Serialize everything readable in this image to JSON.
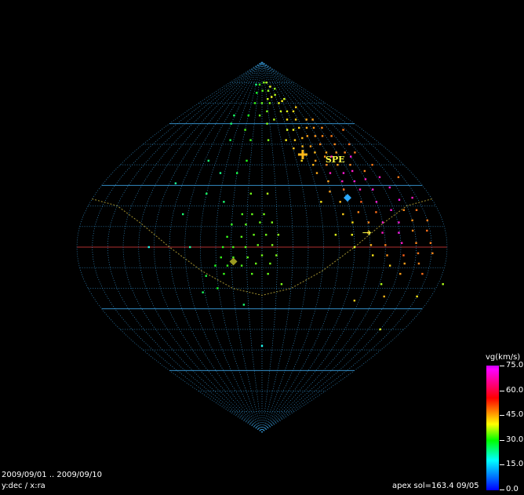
{
  "chart_data": {
    "type": "scatter",
    "projection": "sinusoidal",
    "title": "",
    "xlabel": "ra",
    "ylabel": "dec",
    "date_range_text": "2009/09/01 .. 2009/09/10",
    "axes_text": "y:dec / x:ra",
    "apex_text": "apex sol=163.4 09/05",
    "shower_label": "SPE",
    "shower_label_color": "#ffff44",
    "colorbar": {
      "title": "vg(km/s)",
      "min": 0.0,
      "max": 75.0,
      "ticks": [
        "75.0",
        "60.0",
        "45.0",
        "30.0",
        "15.0",
        "0.0"
      ],
      "tick_values": [
        75,
        60,
        45,
        30,
        15,
        0
      ]
    },
    "grid": true,
    "grid_color": "#3aa0e0",
    "background": "#000000",
    "points": [
      {
        "ra": 205,
        "dec": 80,
        "v": 50
      },
      {
        "ra": 190,
        "dec": 80,
        "v": 45
      },
      {
        "ra": 168,
        "dec": 79,
        "v": 40
      },
      {
        "ra": 150,
        "dec": 79,
        "v": 28
      },
      {
        "ra": 218,
        "dec": 78,
        "v": 55
      },
      {
        "ra": 235,
        "dec": 77,
        "v": 47
      },
      {
        "ra": 205,
        "dec": 76,
        "v": 48
      },
      {
        "ra": 182,
        "dec": 76,
        "v": 42
      },
      {
        "ra": 160,
        "dec": 75,
        "v": 36
      },
      {
        "ra": 226,
        "dec": 74,
        "v": 50
      },
      {
        "ra": 212,
        "dec": 73,
        "v": 56
      },
      {
        "ra": 198,
        "dec": 72,
        "v": 52
      },
      {
        "ra": 250,
        "dec": 72,
        "v": 53
      },
      {
        "ra": 240,
        "dec": 71,
        "v": 57
      },
      {
        "ra": 228,
        "dec": 70,
        "v": 55
      },
      {
        "ra": 202,
        "dec": 70,
        "v": 46
      },
      {
        "ra": 180,
        "dec": 70,
        "v": 44
      },
      {
        "ra": 160,
        "dec": 70,
        "v": 40
      },
      {
        "ra": 268,
        "dec": 68,
        "v": 60
      },
      {
        "ra": 255,
        "dec": 66,
        "v": 58
      },
      {
        "ra": 240,
        "dec": 66,
        "v": 54
      },
      {
        "ra": 225,
        "dec": 66,
        "v": 52
      },
      {
        "ra": 192,
        "dec": 66,
        "v": 45
      },
      {
        "ra": 175,
        "dec": 64,
        "v": 44
      },
      {
        "ra": 150,
        "dec": 64,
        "v": 38
      },
      {
        "ra": 118,
        "dec": 64,
        "v": 32
      },
      {
        "ra": 285,
        "dec": 62,
        "v": 64
      },
      {
        "ra": 272,
        "dec": 62,
        "v": 63
      },
      {
        "ra": 250,
        "dec": 62,
        "v": 60
      },
      {
        "ra": 232,
        "dec": 62,
        "v": 58
      },
      {
        "ra": 205,
        "dec": 62,
        "v": 50
      },
      {
        "ra": 190,
        "dec": 60,
        "v": 46
      },
      {
        "ra": 120,
        "dec": 60,
        "v": 30
      },
      {
        "ra": 290,
        "dec": 58,
        "v": 66
      },
      {
        "ra": 275,
        "dec": 58,
        "v": 65
      },
      {
        "ra": 262,
        "dec": 58,
        "v": 63
      },
      {
        "ra": 248,
        "dec": 58,
        "v": 60
      },
      {
        "ra": 236,
        "dec": 57,
        "v": 56
      },
      {
        "ra": 225,
        "dec": 57,
        "v": 54
      },
      {
        "ra": 150,
        "dec": 57,
        "v": 42
      },
      {
        "ra": 325,
        "dec": 57,
        "v": 67
      },
      {
        "ra": 295,
        "dec": 54,
        "v": 67
      },
      {
        "ra": 280,
        "dec": 54,
        "v": 66
      },
      {
        "ra": 268,
        "dec": 54,
        "v": 65
      },
      {
        "ra": 255,
        "dec": 54,
        "v": 64
      },
      {
        "ra": 245,
        "dec": 53,
        "v": 62
      },
      {
        "ra": 232,
        "dec": 52,
        "v": 60
      },
      {
        "ra": 218,
        "dec": 52,
        "v": 57
      },
      {
        "ra": 190,
        "dec": 52,
        "v": 46
      },
      {
        "ra": 162,
        "dec": 52,
        "v": 40
      },
      {
        "ra": 130,
        "dec": 52,
        "v": 33
      },
      {
        "ra": 312,
        "dec": 50,
        "v": 68
      },
      {
        "ra": 290,
        "dec": 50,
        "v": 66
      },
      {
        "ra": 268,
        "dec": 50,
        "v": 66
      },
      {
        "ra": 252,
        "dec": 49,
        "v": 64
      },
      {
        "ra": 240,
        "dec": 49,
        "v": 62
      },
      {
        "ra": 226,
        "dec": 48,
        "v": 61
      },
      {
        "ra": 310,
        "dec": 46,
        "v": 67
      },
      {
        "ra": 296,
        "dec": 46,
        "v": 66
      },
      {
        "ra": 284,
        "dec": 46,
        "v": 65
      },
      {
        "ra": 270,
        "dec": 46,
        "v": 63
      },
      {
        "ra": 254,
        "dec": 46,
        "v": 62
      },
      {
        "ra": 240,
        "dec": 45,
        "v": 60
      },
      {
        "ra": 300,
        "dec": 44,
        "v": 72
      },
      {
        "ra": 274,
        "dec": 44,
        "v": 70
      },
      {
        "ra": 265,
        "dec": 44,
        "v": 65
      },
      {
        "ra": 250,
        "dec": 42,
        "v": 64
      },
      {
        "ra": 232,
        "dec": 42,
        "v": 59
      },
      {
        "ra": 160,
        "dec": 42,
        "v": 38
      },
      {
        "ra": 110,
        "dec": 42,
        "v": 30
      },
      {
        "ra": 320,
        "dec": 40,
        "v": 67
      },
      {
        "ra": 292,
        "dec": 40,
        "v": 66
      },
      {
        "ra": 276,
        "dec": 40,
        "v": 64
      },
      {
        "ra": 262,
        "dec": 40,
        "v": 66
      },
      {
        "ra": 245,
        "dec": 40,
        "v": 62
      },
      {
        "ra": 305,
        "dec": 37,
        "v": 66
      },
      {
        "ra": 290,
        "dec": 37,
        "v": 71
      },
      {
        "ra": 278,
        "dec": 36,
        "v": 72
      },
      {
        "ra": 262,
        "dec": 36,
        "v": 70
      },
      {
        "ra": 246,
        "dec": 36,
        "v": 63
      },
      {
        "ra": 150,
        "dec": 36,
        "v": 34
      },
      {
        "ra": 130,
        "dec": 36,
        "v": 28
      },
      {
        "ra": 340,
        "dec": 34,
        "v": 67
      },
      {
        "ra": 318,
        "dec": 34,
        "v": 70
      },
      {
        "ra": 300,
        "dec": 33,
        "v": 70
      },
      {
        "ra": 286,
        "dec": 32,
        "v": 72
      },
      {
        "ra": 272,
        "dec": 32,
        "v": 70
      },
      {
        "ra": 256,
        "dec": 32,
        "v": 64
      },
      {
        "ra": 82,
        "dec": 31,
        "v": 27
      },
      {
        "ra": 322,
        "dec": 29,
        "v": 71
      },
      {
        "ra": 302,
        "dec": 28,
        "v": 72
      },
      {
        "ra": 288,
        "dec": 28,
        "v": 70
      },
      {
        "ra": 270,
        "dec": 28,
        "v": 68
      },
      {
        "ra": 254,
        "dec": 27,
        "v": 64
      },
      {
        "ra": 186,
        "dec": 26,
        "v": 50
      },
      {
        "ra": 168,
        "dec": 26,
        "v": 45
      },
      {
        "ra": 120,
        "dec": 26,
        "v": 32
      },
      {
        "ra": 340,
        "dec": 24,
        "v": 70
      },
      {
        "ra": 325,
        "dec": 23,
        "v": 74
      },
      {
        "ra": 300,
        "dec": 22,
        "v": 71
      },
      {
        "ra": 284,
        "dec": 22,
        "v": 69
      },
      {
        "ra": 262,
        "dec": 22,
        "v": 62
      },
      {
        "ra": 242,
        "dec": 22,
        "v": 58
      },
      {
        "ra": 140,
        "dec": 22,
        "v": 30
      },
      {
        "ra": 338,
        "dec": 18,
        "v": 68
      },
      {
        "ra": 325,
        "dec": 18,
        "v": 66
      },
      {
        "ra": 312,
        "dec": 18,
        "v": 72
      },
      {
        "ra": 296,
        "dec": 17,
        "v": 68
      },
      {
        "ra": 278,
        "dec": 17,
        "v": 66
      },
      {
        "ra": 262,
        "dec": 16,
        "v": 60
      },
      {
        "ra": 182,
        "dec": 16,
        "v": 45
      },
      {
        "ra": 170,
        "dec": 16,
        "v": 44
      },
      {
        "ra": 160,
        "dec": 16,
        "v": 42
      },
      {
        "ra": 100,
        "dec": 16,
        "v": 30
      },
      {
        "ra": 345,
        "dec": 13,
        "v": 67
      },
      {
        "ra": 330,
        "dec": 13,
        "v": 65
      },
      {
        "ra": 316,
        "dec": 12,
        "v": 72
      },
      {
        "ra": 300,
        "dec": 12,
        "v": 70
      },
      {
        "ra": 286,
        "dec": 12,
        "v": 66
      },
      {
        "ra": 270,
        "dec": 12,
        "v": 58
      },
      {
        "ra": 190,
        "dec": 12,
        "v": 46
      },
      {
        "ra": 178,
        "dec": 12,
        "v": 44
      },
      {
        "ra": 164,
        "dec": 11,
        "v": 43
      },
      {
        "ra": 150,
        "dec": 11,
        "v": 40
      },
      {
        "ra": 342,
        "dec": 8,
        "v": 68
      },
      {
        "ra": 328,
        "dec": 8,
        "v": 66
      },
      {
        "ra": 314,
        "dec": 7,
        "v": 73
      },
      {
        "ra": 298,
        "dec": 7,
        "v": 70
      },
      {
        "ra": 284,
        "dec": 7,
        "v": 64
      },
      {
        "ra": 268,
        "dec": 6,
        "v": 56
      },
      {
        "ra": 252,
        "dec": 6,
        "v": 54
      },
      {
        "ra": 196,
        "dec": 6,
        "v": 47
      },
      {
        "ra": 184,
        "dec": 6,
        "v": 45
      },
      {
        "ra": 172,
        "dec": 6,
        "v": 44
      },
      {
        "ra": 160,
        "dec": 5,
        "v": 43
      },
      {
        "ra": 146,
        "dec": 5,
        "v": 40
      },
      {
        "ra": 344,
        "dec": 2,
        "v": 67
      },
      {
        "ra": 330,
        "dec": 2,
        "v": 66
      },
      {
        "ra": 316,
        "dec": 2,
        "v": 70
      },
      {
        "ra": 300,
        "dec": 1,
        "v": 67
      },
      {
        "ra": 286,
        "dec": 1,
        "v": 62
      },
      {
        "ra": 270,
        "dec": 0,
        "v": 55
      },
      {
        "ra": 190,
        "dec": 1,
        "v": 46
      },
      {
        "ra": 176,
        "dec": 1,
        "v": 44
      },
      {
        "ra": 164,
        "dec": 0,
        "v": 43
      },
      {
        "ra": 152,
        "dec": 0,
        "v": 41
      },
      {
        "ra": 142,
        "dec": 0,
        "v": 39
      },
      {
        "ra": 110,
        "dec": 0,
        "v": 26
      },
      {
        "ra": 70,
        "dec": 0,
        "v": 20
      },
      {
        "ra": 346,
        "dec": -3,
        "v": 66
      },
      {
        "ra": 332,
        "dec": -3,
        "v": 67
      },
      {
        "ra": 318,
        "dec": -4,
        "v": 69
      },
      {
        "ra": 302,
        "dec": -4,
        "v": 65
      },
      {
        "ra": 288,
        "dec": -4,
        "v": 58
      },
      {
        "ra": 194,
        "dec": -4,
        "v": 46
      },
      {
        "ra": 180,
        "dec": -4,
        "v": 45
      },
      {
        "ra": 166,
        "dec": -5,
        "v": 43
      },
      {
        "ra": 152,
        "dec": -5,
        "v": 41
      },
      {
        "ra": 140,
        "dec": -5,
        "v": 40
      },
      {
        "ra": 334,
        "dec": -8,
        "v": 66
      },
      {
        "ra": 320,
        "dec": -8,
        "v": 64
      },
      {
        "ra": 306,
        "dec": -9,
        "v": 60
      },
      {
        "ra": 188,
        "dec": -8,
        "v": 45
      },
      {
        "ra": 174,
        "dec": -8,
        "v": 44
      },
      {
        "ra": 160,
        "dec": -9,
        "v": 42
      },
      {
        "ra": 146,
        "dec": -9,
        "v": 40
      },
      {
        "ra": 134,
        "dec": -9,
        "v": 38
      },
      {
        "ra": 340,
        "dec": -13,
        "v": 68
      },
      {
        "ra": 318,
        "dec": -13,
        "v": 64
      },
      {
        "ra": 186,
        "dec": -13,
        "v": 44
      },
      {
        "ra": 170,
        "dec": -13,
        "v": 43
      },
      {
        "ra": 142,
        "dec": -13,
        "v": 40
      },
      {
        "ra": 124,
        "dec": -14,
        "v": 34
      },
      {
        "ra": 365,
        "dec": -18,
        "v": 50
      },
      {
        "ra": 302,
        "dec": -18,
        "v": 50
      },
      {
        "ra": 200,
        "dec": -18,
        "v": 46
      },
      {
        "ra": 134,
        "dec": -20,
        "v": 36
      },
      {
        "ra": 118,
        "dec": -22,
        "v": 32
      },
      {
        "ra": 345,
        "dec": -24,
        "v": 58
      },
      {
        "ra": 310,
        "dec": -24,
        "v": 62
      },
      {
        "ra": 280,
        "dec": -26,
        "v": 60
      },
      {
        "ra": 160,
        "dec": -28,
        "v": 30
      },
      {
        "ra": 330,
        "dec": -40,
        "v": 55
      },
      {
        "ra": 180,
        "dec": -48,
        "v": 20
      }
    ],
    "markers": [
      {
        "type": "shower-radiant",
        "ra": 236,
        "dec": 45,
        "v": 62,
        "label": "SPE"
      },
      {
        "type": "diamond",
        "ra": 271,
        "dec": 24,
        "color": "#2aa8ff"
      },
      {
        "type": "diamond",
        "ra": 152,
        "dec": -7,
        "color": "#9a9a20"
      },
      {
        "type": "arrow",
        "ra": 284,
        "dec": 7,
        "color": "#ffff44"
      }
    ],
    "ecliptic": {
      "color": "#a09030",
      "points": [
        {
          "ra": 360,
          "dec": 23.4
        },
        {
          "ra": 330,
          "dec": 20.1
        },
        {
          "ra": 300,
          "dec": 11.5
        },
        {
          "ra": 270,
          "dec": 0
        },
        {
          "ra": 240,
          "dec": -11.5
        },
        {
          "ra": 210,
          "dec": -20.1
        },
        {
          "ra": 180,
          "dec": -23.4
        },
        {
          "ra": 150,
          "dec": -20.1
        },
        {
          "ra": 120,
          "dec": -11.5
        },
        {
          "ra": 90,
          "dec": 0
        },
        {
          "ra": 60,
          "dec": 11.5
        },
        {
          "ra": 30,
          "dec": 20.1
        },
        {
          "ra": 0,
          "dec": 23.4
        }
      ]
    }
  }
}
